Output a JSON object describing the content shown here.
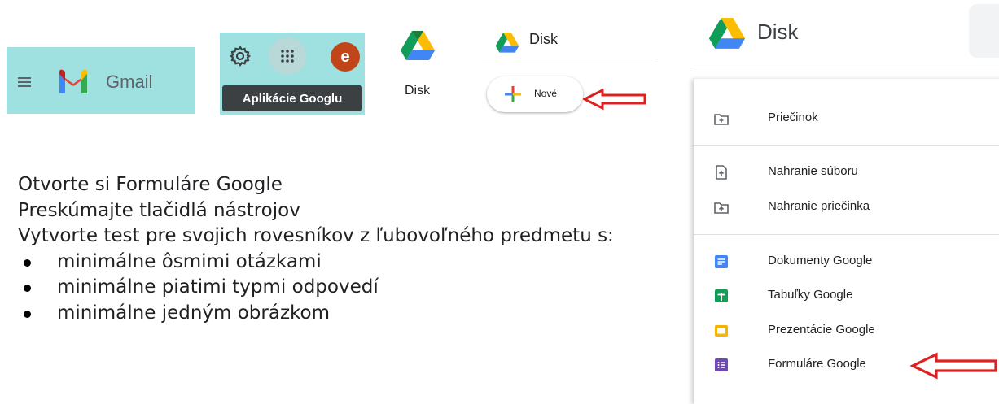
{
  "gmail": {
    "title": "Gmail"
  },
  "apps": {
    "avatar_letter": "e",
    "tooltip": "Aplikácie Googlu"
  },
  "drive_icon": {
    "label": "Disk"
  },
  "drive_small": {
    "title": "Disk",
    "new_button": "Nové"
  },
  "instructions": {
    "lines": [
      "Otvorte si Formuláre Google",
      "Preskúmajte tlačidlá nástrojov",
      "Vytvorte test pre svojich rovesníkov z ľubovoľného predmetu s:"
    ],
    "bullets": [
      "minimálne ôsmimi otázkami",
      "minimálne piatimi typmi odpovedí",
      "minimálne jedným obrázkom"
    ]
  },
  "drive_menu": {
    "title": "Disk",
    "items": [
      {
        "label": "Priečinok",
        "icon": "new-folder-icon"
      },
      {
        "label": "Nahranie súboru",
        "icon": "file-upload-icon"
      },
      {
        "label": "Nahranie priečinka",
        "icon": "folder-upload-icon"
      },
      {
        "label": "Dokumenty Google",
        "icon": "google-docs-icon",
        "color": "#4285f4"
      },
      {
        "label": "Tabuľky Google",
        "icon": "google-sheets-icon",
        "color": "#0f9d58"
      },
      {
        "label": "Prezentácie Google",
        "icon": "google-slides-icon",
        "color": "#f4b400"
      },
      {
        "label": "Formuláre Google",
        "icon": "google-forms-icon",
        "color": "#7248b9"
      }
    ]
  },
  "colors": {
    "crop_background": "#9fe0e0",
    "annotation_arrow": "#e02020",
    "avatar": "#c0461a"
  }
}
